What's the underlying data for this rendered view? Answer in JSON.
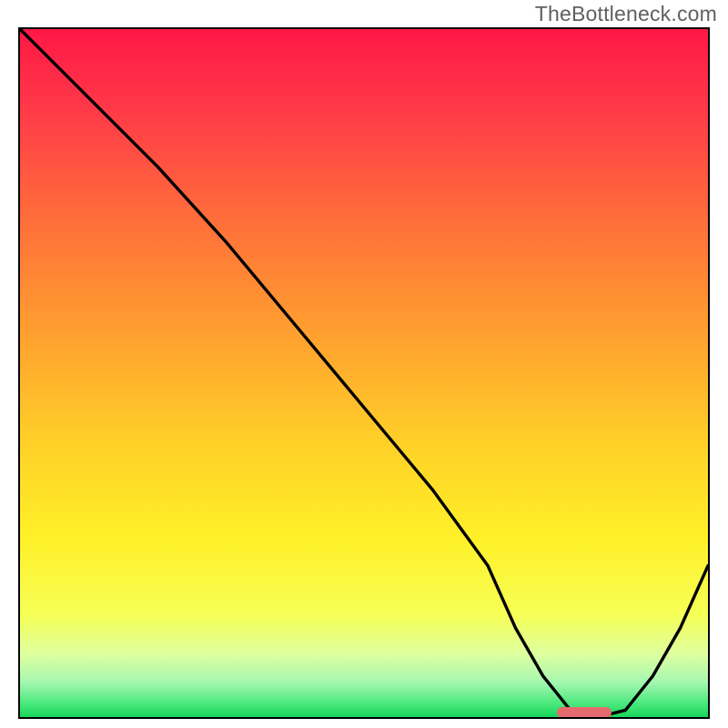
{
  "watermark": "TheBottleneck.com",
  "chart_data": {
    "type": "line",
    "title": "",
    "xlabel": "",
    "ylabel": "",
    "xlim": [
      0,
      100
    ],
    "ylim": [
      0,
      100
    ],
    "grid": false,
    "series": [
      {
        "name": "bottleneck-curve",
        "x": [
          0,
          8,
          20,
          30,
          40,
          50,
          60,
          68,
          72,
          76,
          80,
          84,
          88,
          92,
          96,
          100
        ],
        "y": [
          100,
          92,
          80,
          69,
          57,
          45,
          33,
          22,
          13,
          6,
          1,
          0,
          1,
          6,
          13,
          22
        ]
      }
    ],
    "optimal_marker": {
      "x_start": 78,
      "x_end": 86,
      "y": 0.6
    },
    "gradient_stops": [
      {
        "offset": 0.0,
        "color": "#ff1846"
      },
      {
        "offset": 0.12,
        "color": "#ff3a48"
      },
      {
        "offset": 0.28,
        "color": "#ff6f3a"
      },
      {
        "offset": 0.45,
        "color": "#ffa22f"
      },
      {
        "offset": 0.6,
        "color": "#ffd028"
      },
      {
        "offset": 0.74,
        "color": "#fff028"
      },
      {
        "offset": 0.85,
        "color": "#f6ff55"
      },
      {
        "offset": 0.91,
        "color": "#ddffa0"
      },
      {
        "offset": 0.95,
        "color": "#a4f7b0"
      },
      {
        "offset": 0.98,
        "color": "#4be97d"
      },
      {
        "offset": 1.0,
        "color": "#17d65a"
      }
    ]
  }
}
